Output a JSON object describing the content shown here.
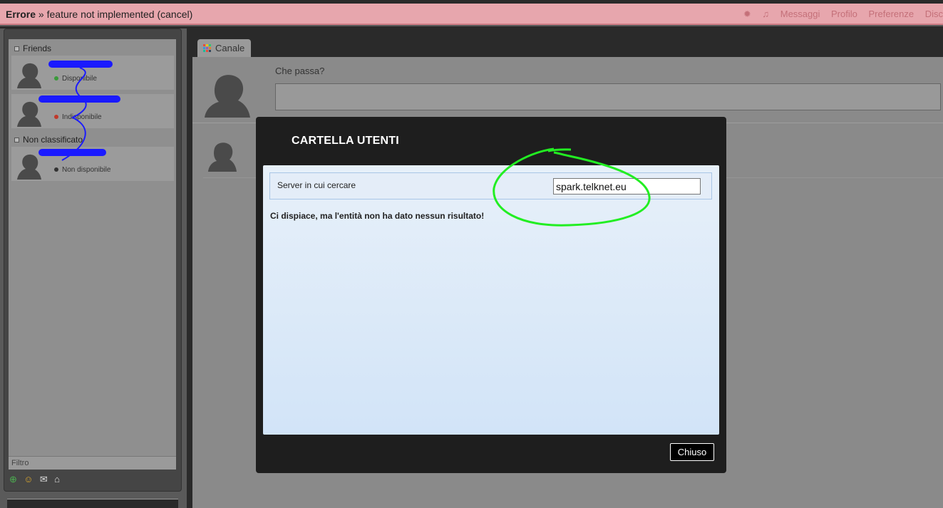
{
  "error_bar": {
    "label": "Errore",
    "separator": "»",
    "message": "feature not implemented (cancel)",
    "menu": [
      "Messaggi",
      "Profilo",
      "Preferenze",
      "Disc"
    ]
  },
  "roster": {
    "groups": [
      {
        "title": "Friends",
        "contacts": [
          {
            "status_text": "Disponibile",
            "status_color": "#3a9a3a"
          },
          {
            "status_text": "Indisponibile",
            "status_color": "#c0392b"
          }
        ]
      },
      {
        "title": "Non classificato",
        "contacts": [
          {
            "status_text": "Non disponibile",
            "status_color": "#333333"
          }
        ]
      }
    ],
    "filter_placeholder": "Filtro"
  },
  "channel": {
    "tab_label": "Canale",
    "compose_label": "Che passa?"
  },
  "modal": {
    "title": "CARTELLA UTENTI",
    "search_label": "Server in cui cercare",
    "search_value": "spark.telknet.eu",
    "no_result_text": "Ci dispiace, ma l'entità non ha dato nessun risultato!",
    "close_label": "Chiuso"
  },
  "colors": {
    "error_bar": "#e7a6ad",
    "annotation_circle": "#22ee22",
    "redaction": "#1a1aff"
  }
}
